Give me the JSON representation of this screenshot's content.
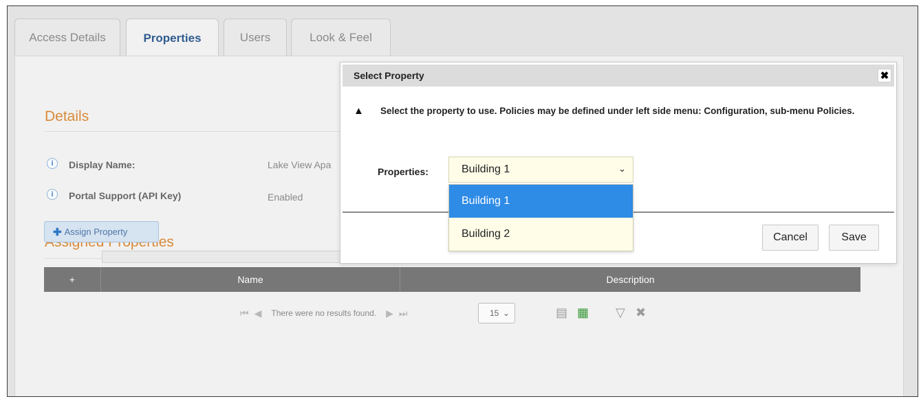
{
  "tabs": [
    {
      "label": "Access Details",
      "active": false
    },
    {
      "label": "Properties",
      "active": true
    },
    {
      "label": "Users",
      "active": false
    },
    {
      "label": "Look & Feel",
      "active": false
    }
  ],
  "details": {
    "title": "Details",
    "fields": [
      {
        "label": "Display Name:",
        "value": "Lake View Apa"
      },
      {
        "label": "Portal Support (API Key)",
        "value": "Enabled"
      }
    ]
  },
  "assigned": {
    "title": "Assigned Properties",
    "assign_button": "Assign Property",
    "table": {
      "add_symbol": "+",
      "columns": [
        "Name",
        "Description"
      ]
    },
    "pager": {
      "message": "There were no results found.",
      "page_size": "15"
    }
  },
  "modal": {
    "title": "Select Property",
    "close_symbol": "✖",
    "warning_icon": "warning-icon",
    "message": "Select the property to use. Policies may be defined under left side menu: Configuration, sub-menu Policies.",
    "properties_label": "Properties:",
    "selected_property": "Building 1",
    "options": [
      "Building 1",
      "Building 2"
    ],
    "cancel_label": "Cancel",
    "save_label": "Save"
  },
  "colors": {
    "accent_orange": "#d88a38",
    "tab_active_blue": "#2f5c8f",
    "option_selected": "#2e8be6",
    "table_header": "#777777",
    "select_bg": "#fffde8"
  }
}
